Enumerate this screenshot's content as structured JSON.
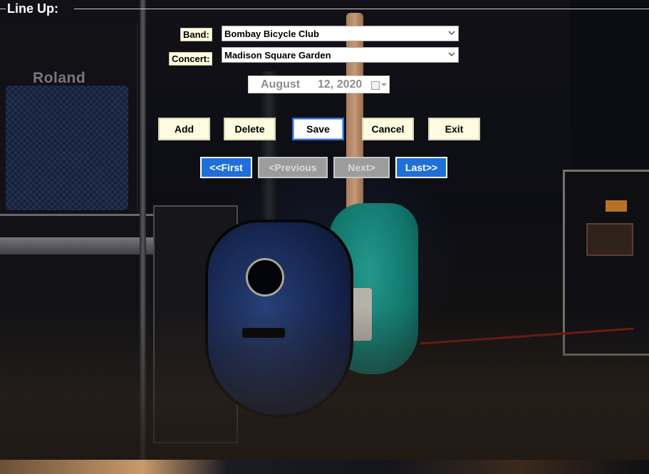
{
  "title": "Line Up:",
  "form": {
    "band_label": "Band:",
    "band_value": "Bombay Bicycle Club",
    "concert_label": "Concert:",
    "concert_value": "Madison Square Garden",
    "date_month": "August",
    "date_rest": "12, 2020"
  },
  "buttons": {
    "add": "Add",
    "delete": "Delete",
    "save": "Save",
    "cancel": "Cancel",
    "exit": "Exit"
  },
  "navigation": {
    "first": "<<First",
    "previous": "<Previous",
    "next": "Next>",
    "last": "Last>>"
  },
  "background": {
    "amp_brand": "Roland"
  },
  "colors": {
    "label_background": "#fffbe0",
    "nav_active": "#1f6fd8",
    "nav_disabled": "#9c9c9c",
    "focus_border": "#2f6fd6"
  }
}
